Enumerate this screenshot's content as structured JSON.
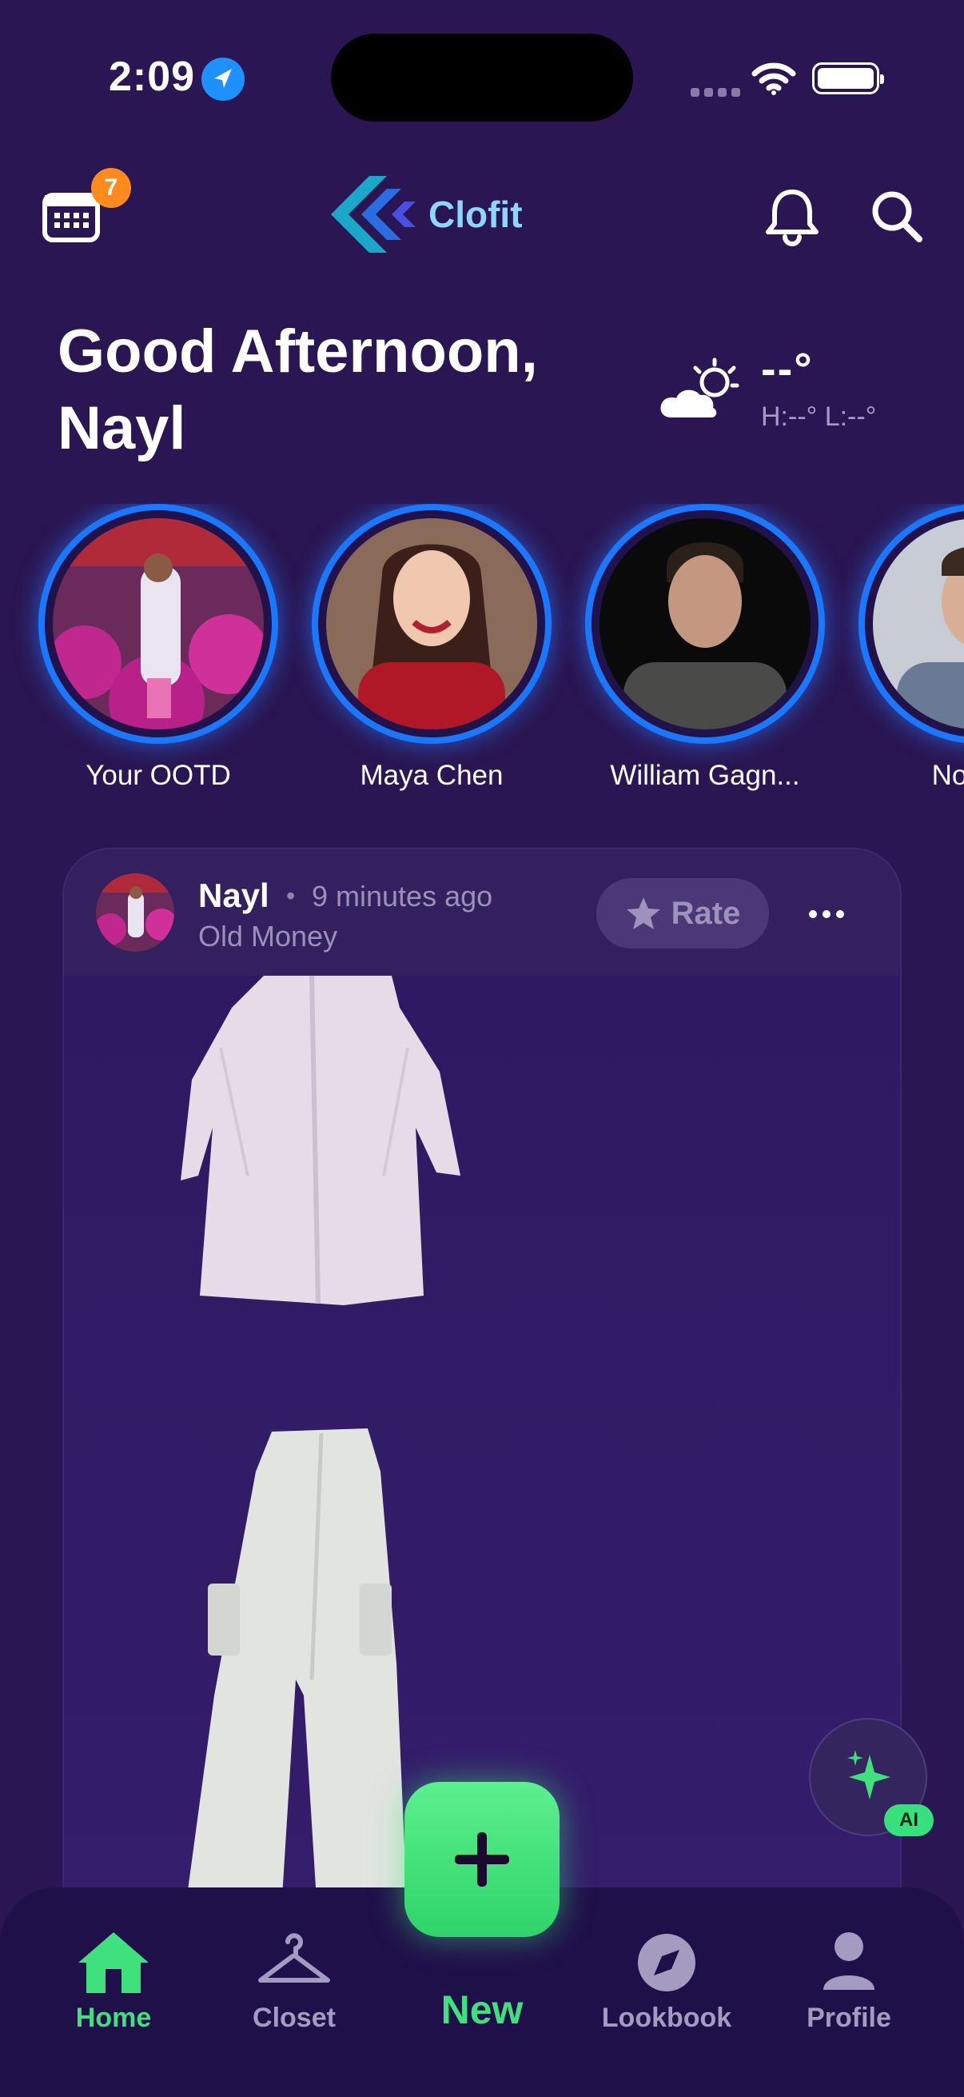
{
  "status_bar": {
    "time": "2:09"
  },
  "header": {
    "calendar_badge": "7",
    "logo_text": "Clofit"
  },
  "greeting": "Good Afternoon, Nayl",
  "weather": {
    "temp": "--°",
    "hilo": "H:--° L:--°"
  },
  "stories": [
    {
      "label": "Your OOTD"
    },
    {
      "label": "Maya Chen"
    },
    {
      "label": "William Gagn..."
    },
    {
      "label": "Noah V"
    }
  ],
  "post": {
    "user": "Nayl",
    "separator": "•",
    "time": "9 minutes ago",
    "tag": "Old Money",
    "rate_label": "Rate"
  },
  "ai_fab": {
    "badge": "AI"
  },
  "bottom_nav": {
    "items": [
      {
        "label": "Home"
      },
      {
        "label": "Closet"
      },
      {
        "label": "New"
      },
      {
        "label": "Lookbook"
      },
      {
        "label": "Profile"
      }
    ]
  },
  "colors": {
    "background": "#2a1652",
    "accent_green": "#3ee17c",
    "ring_blue": "#1a78ff",
    "badge_orange": "#ff8a1e",
    "logo_cyan": "#8fd6ff"
  }
}
